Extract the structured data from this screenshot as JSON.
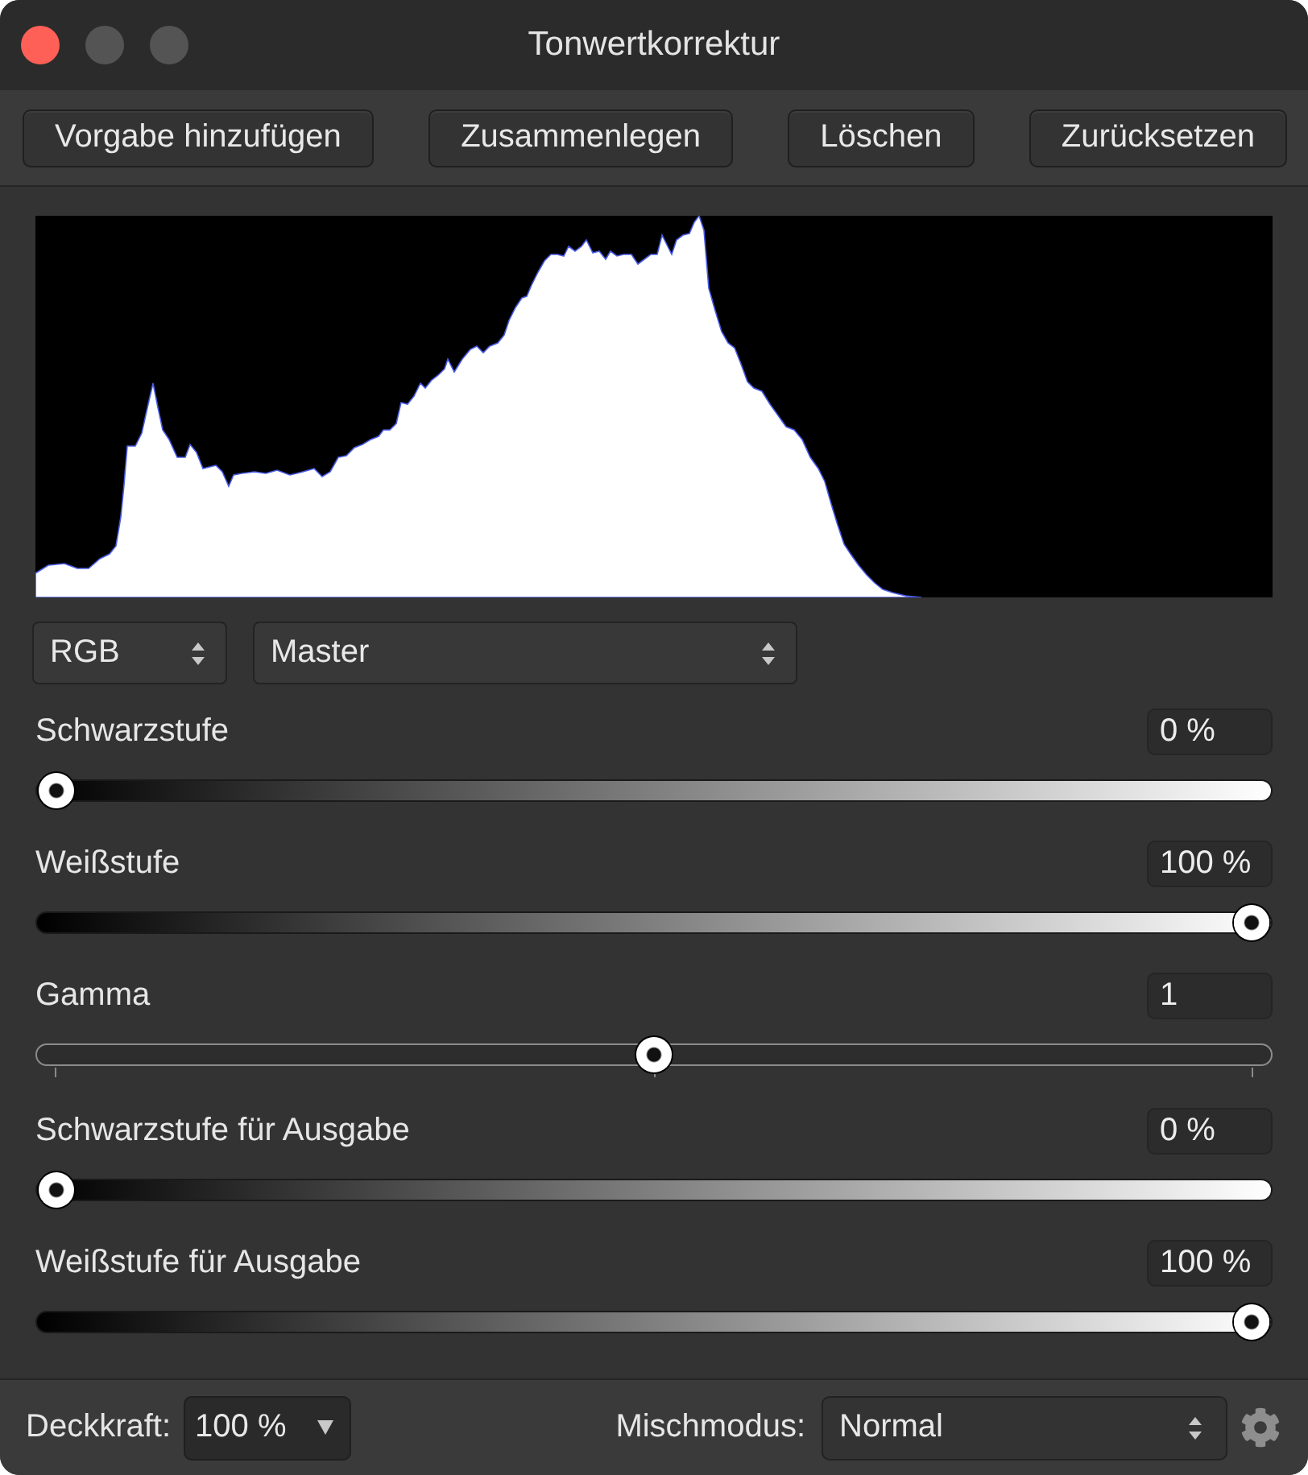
{
  "window": {
    "title": "Tonwertkorrektur"
  },
  "toolbar": {
    "buttons": [
      "Vorgabe hinzufügen",
      "Zusammenlegen",
      "Löschen",
      "Zurücksetzen"
    ]
  },
  "selectors": {
    "color_model": "RGB",
    "channel": "Master"
  },
  "sliders": [
    {
      "label": "Schwarzstufe",
      "value": "0 %",
      "level": 0,
      "kind": "gradient"
    },
    {
      "label": "Weißstufe",
      "value": "100 %",
      "level": 1,
      "kind": "gradient"
    },
    {
      "label": "Gamma",
      "value": "1",
      "level": 0.5,
      "kind": "ticked"
    },
    {
      "label": "Schwarzstufe für Ausgabe",
      "value": "0 %",
      "level": 0,
      "kind": "gradient"
    },
    {
      "label": "Weißstufe für Ausgabe",
      "value": "100 %",
      "level": 1,
      "kind": "gradient"
    }
  ],
  "footer": {
    "opacity": {
      "label": "Deckkraft:",
      "value": "100 %"
    },
    "blend_mode": {
      "label": "Mischmodus:",
      "value": "Normal"
    }
  }
}
